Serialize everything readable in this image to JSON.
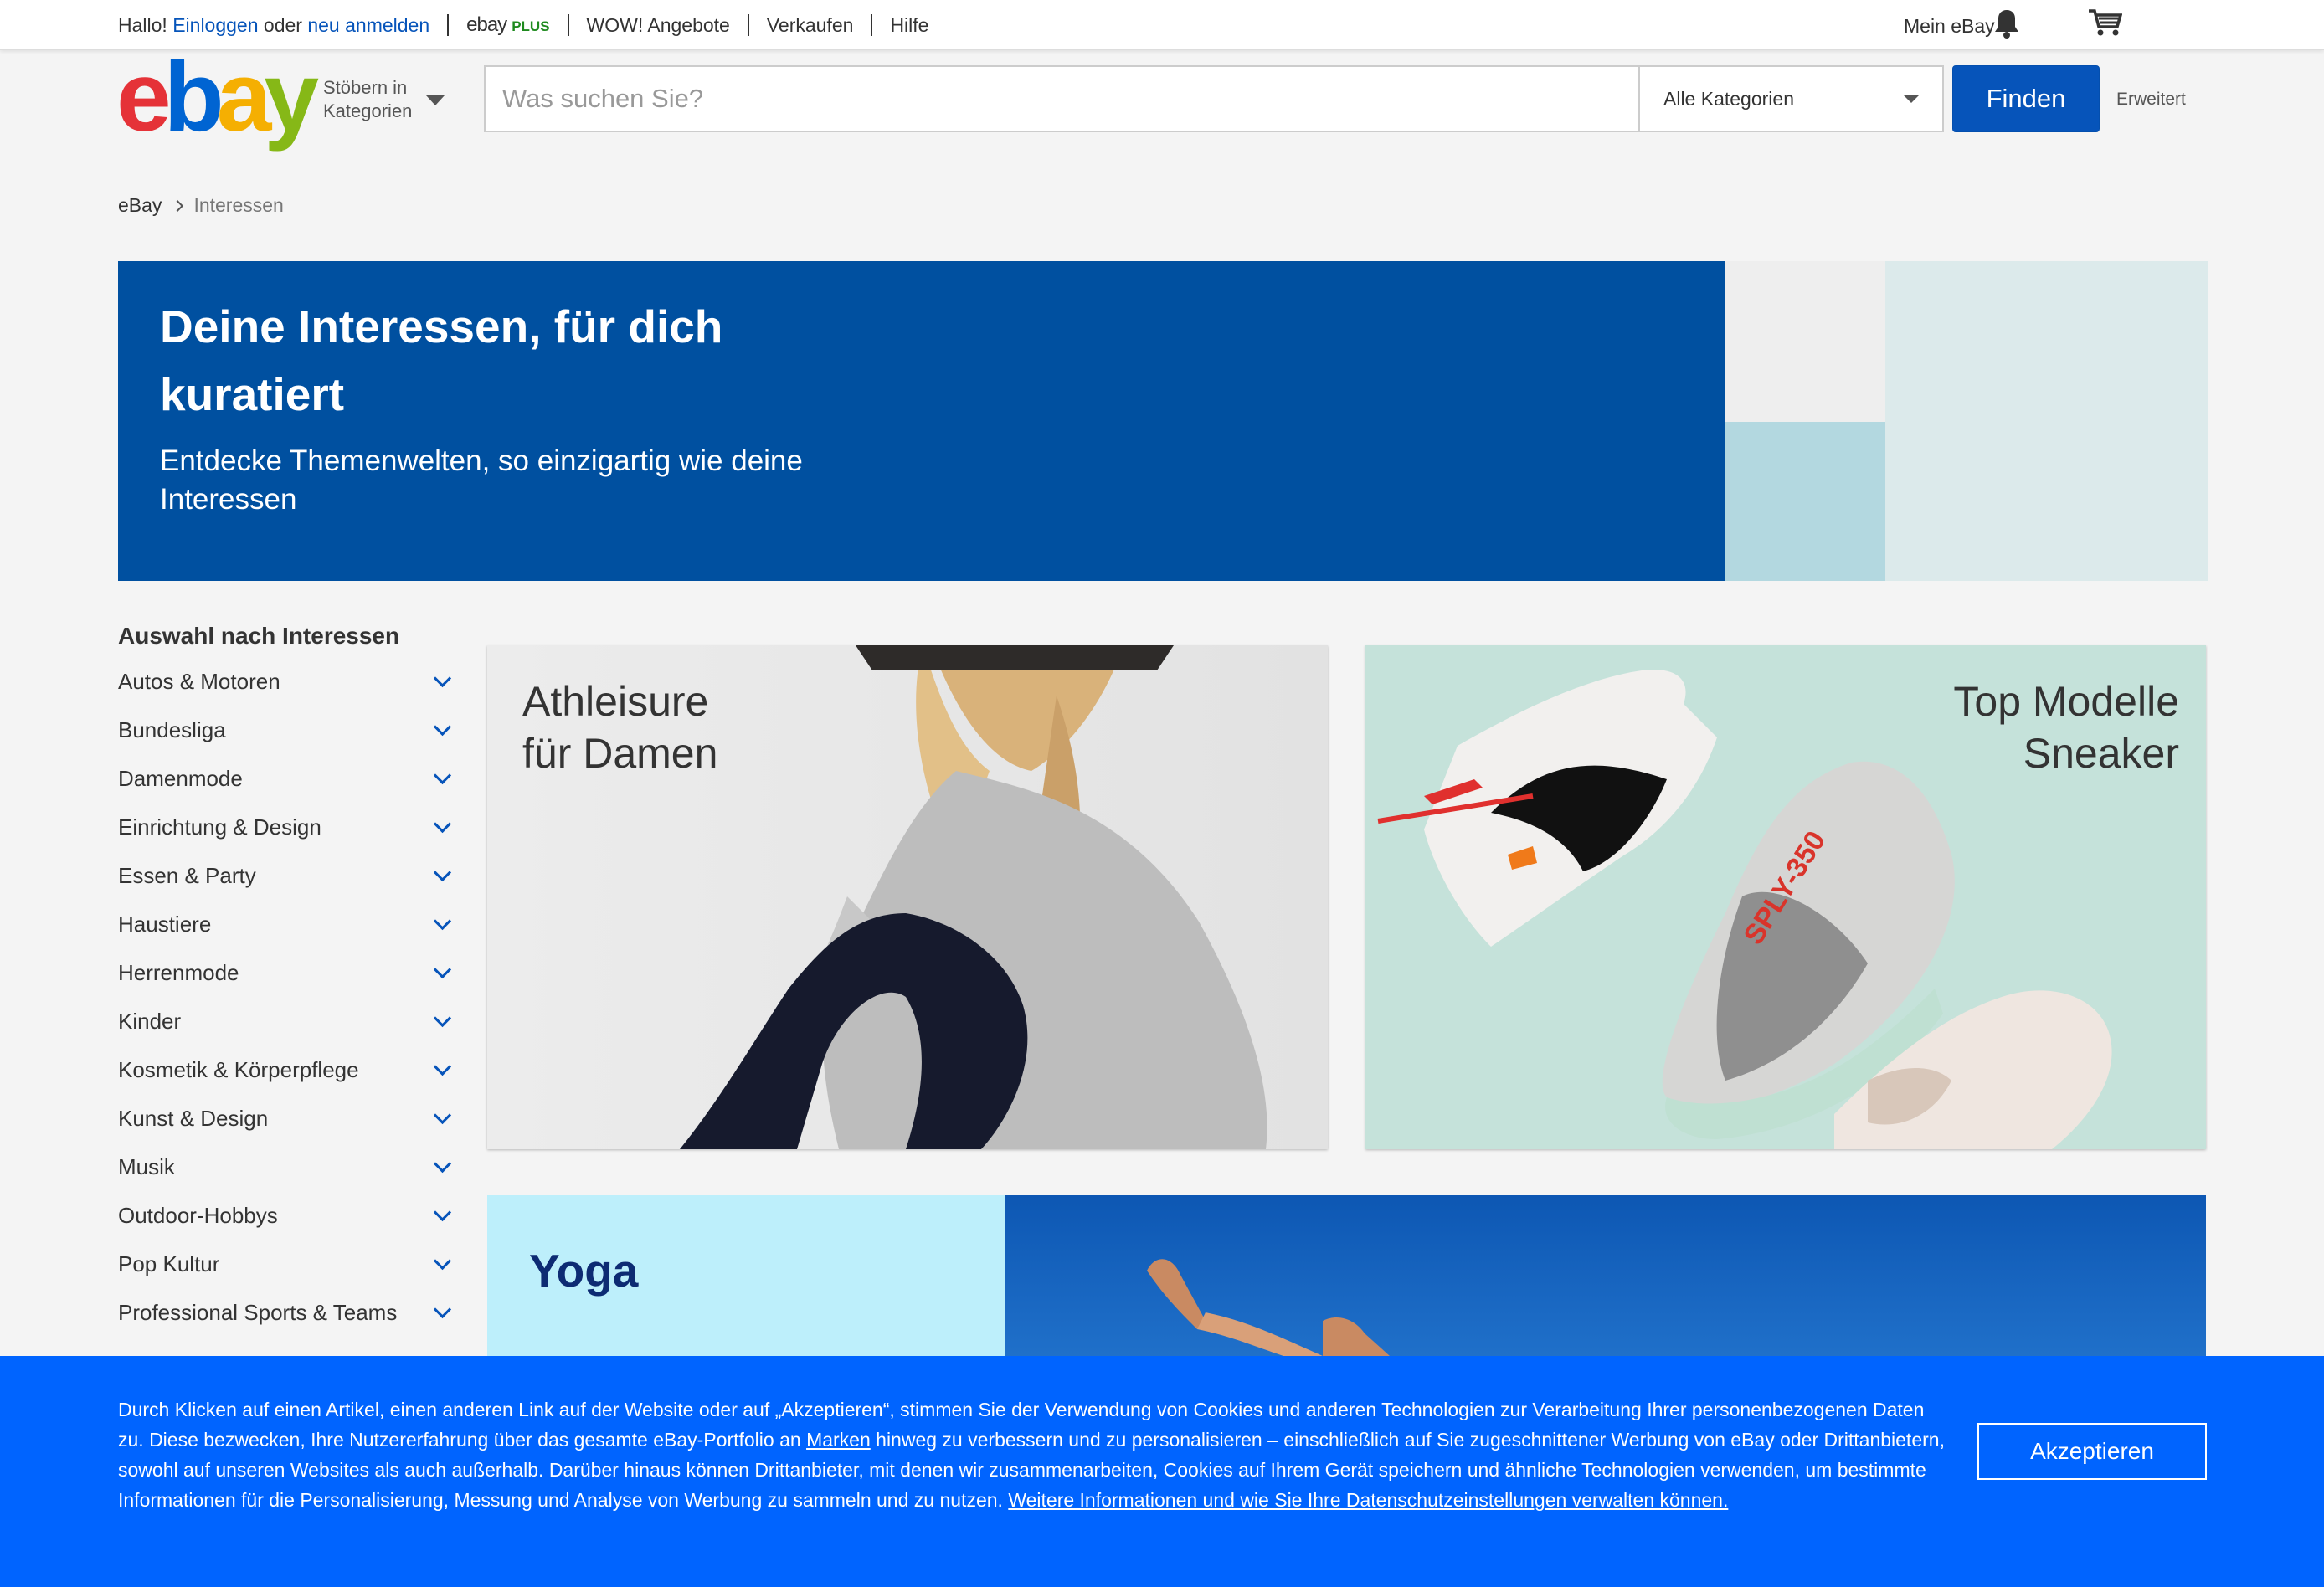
{
  "topbar": {
    "greeting": "Hallo!",
    "login": "Einloggen",
    "or": "oder",
    "register": "neu anmelden",
    "ebay_plus_brand": "ebay",
    "ebay_plus_tag": "PLUS",
    "deals": "WOW! Angebote",
    "sell": "Verkaufen",
    "help": "Hilfe",
    "my_ebay": "Mein eBay"
  },
  "header": {
    "logo": [
      "e",
      "b",
      "a",
      "y"
    ],
    "browse_line1": "Stöbern in",
    "browse_line2": "Kategorien",
    "search_placeholder": "Was suchen Sie?",
    "category_select": "Alle Kategorien",
    "find_button": "Finden",
    "advanced": "Erweitert"
  },
  "breadcrumb": {
    "home": "eBay",
    "current": "Interessen"
  },
  "hero": {
    "title": "Deine Interessen, für dich kuratiert",
    "subtitle": "Entdecke Themenwelten, so einzigartig wie deine Interessen"
  },
  "sidebar": {
    "title": "Auswahl nach Interessen",
    "items": [
      "Autos & Motoren",
      "Bundesliga",
      "Damenmode",
      "Einrichtung & Design",
      "Essen & Party",
      "Haustiere",
      "Herrenmode",
      "Kinder",
      "Kosmetik & Körperpflege",
      "Kunst & Design",
      "Musik",
      "Outdoor-Hobbys",
      "Pop Kultur",
      "Professional Sports & Teams"
    ]
  },
  "cards": [
    {
      "title_line1": "Athleisure",
      "title_line2": "für Damen"
    },
    {
      "title_line1": "Top Modelle",
      "title_line2": "Sneaker"
    }
  ],
  "yoga": {
    "title": "Yoga"
  },
  "cookie": {
    "part1": "Durch Klicken auf einen Artikel, einen anderen Link auf der Website oder auf „Akzeptieren“, stimmen Sie der Verwendung von Cookies und anderen Technologien zur Verarbeitung Ihrer personenbezogenen Daten zu. Diese bezwecken, Ihre Nutzererfahrung über das gesamte eBay-Portfolio an ",
    "brands_link": "Marken",
    "part2": " hinweg zu verbessern und zu personalisieren – einschließlich auf Sie zugeschnittener Werbung von eBay oder Drittanbietern, sowohl auf unseren Websites als auch außerhalb. Darüber hinaus können Drittanbieter, mit denen wir zusammenarbeiten, Cookies auf Ihrem Gerät speichern und ähnliche Technologien verwenden, um bestimmte Informationen für die Personalisierung, Messung und Analyse von Werbung zu sammeln und zu nutzen. ",
    "more_link": "Weitere Informationen und wie Sie Ihre Datenschutzeinstellungen verwalten können.",
    "accept_button": "Akzeptieren"
  },
  "colors": {
    "brand_blue": "#0654ba",
    "hero_blue": "#0050a0",
    "cookie_blue": "#0064ff"
  }
}
